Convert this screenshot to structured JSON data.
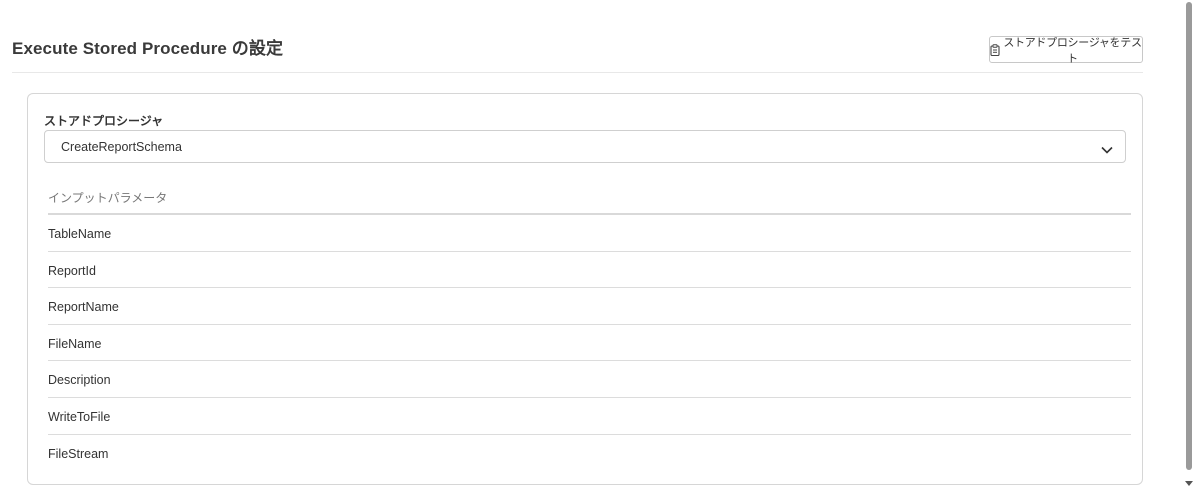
{
  "header": {
    "title": "Execute Stored Procedure の設定",
    "test_button_label": "ストアドプロシージャをテスト",
    "test_button_icon": "clipboard-icon"
  },
  "procedure": {
    "label": "ストアドプロシージャ",
    "selected": "CreateReportSchema"
  },
  "input_parameters": {
    "header": "インプットパラメータ",
    "items": [
      "TableName",
      "ReportId",
      "ReportName",
      "FileName",
      "Description",
      "WriteToFile",
      "FileStream"
    ]
  }
}
